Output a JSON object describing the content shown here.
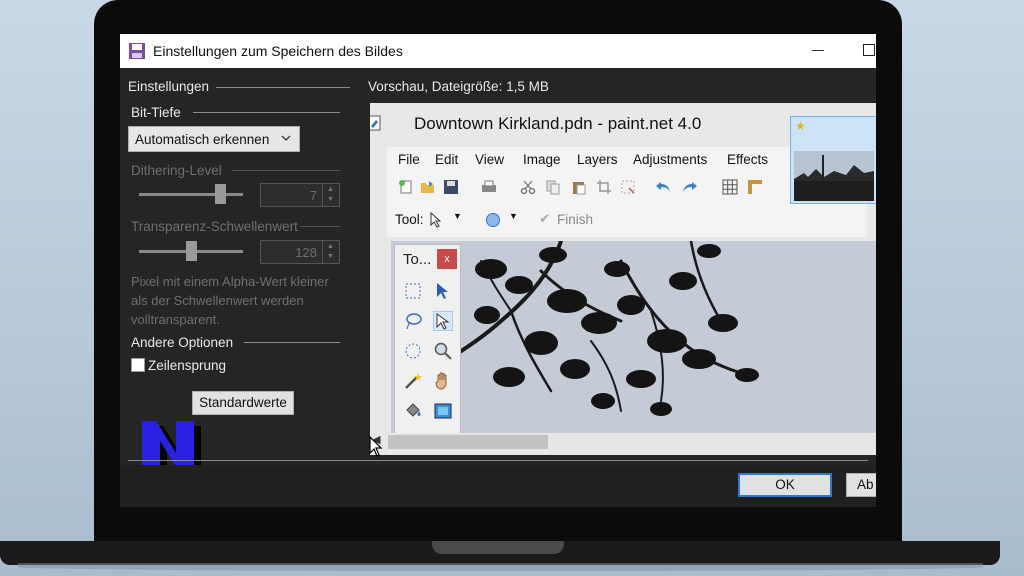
{
  "dialog": {
    "title": "Einstellungen zum Speichern des Bildes",
    "left_heading": "Einstellungen",
    "preview_heading": "Vorschau, Dateigröße: 1,5 MB",
    "bit_depth": {
      "heading": "Bit-Tiefe",
      "selected": "Automatisch erkennen"
    },
    "dithering": {
      "label": "Dithering-Level",
      "value": "7",
      "level_fraction": 0.78
    },
    "transparency": {
      "label": "Transparenz-Schwellenwert",
      "value": "128",
      "level_fraction": 0.5
    },
    "help_text": "Pixel mit einem Alpha-Wert kleiner als der Schwellenwert werden volltransparent.",
    "other_options": {
      "heading": "Andere Optionen",
      "interlace_label": "Zeilensprung",
      "interlace_checked": false
    },
    "defaults_button": "Standardwerte",
    "ok_button": "OK",
    "cancel_button": "Ab"
  },
  "preview": {
    "window_title": "Downtown Kirkland.pdn - paint.net 4.0",
    "menu": [
      "File",
      "Edit",
      "View",
      "Image",
      "Layers",
      "Adjustments",
      "Effects"
    ],
    "tool_label": "Tool:",
    "finish_label": "Finish",
    "tools_window_title": "To...",
    "tools_close": "x"
  },
  "logo_letter": "N"
}
